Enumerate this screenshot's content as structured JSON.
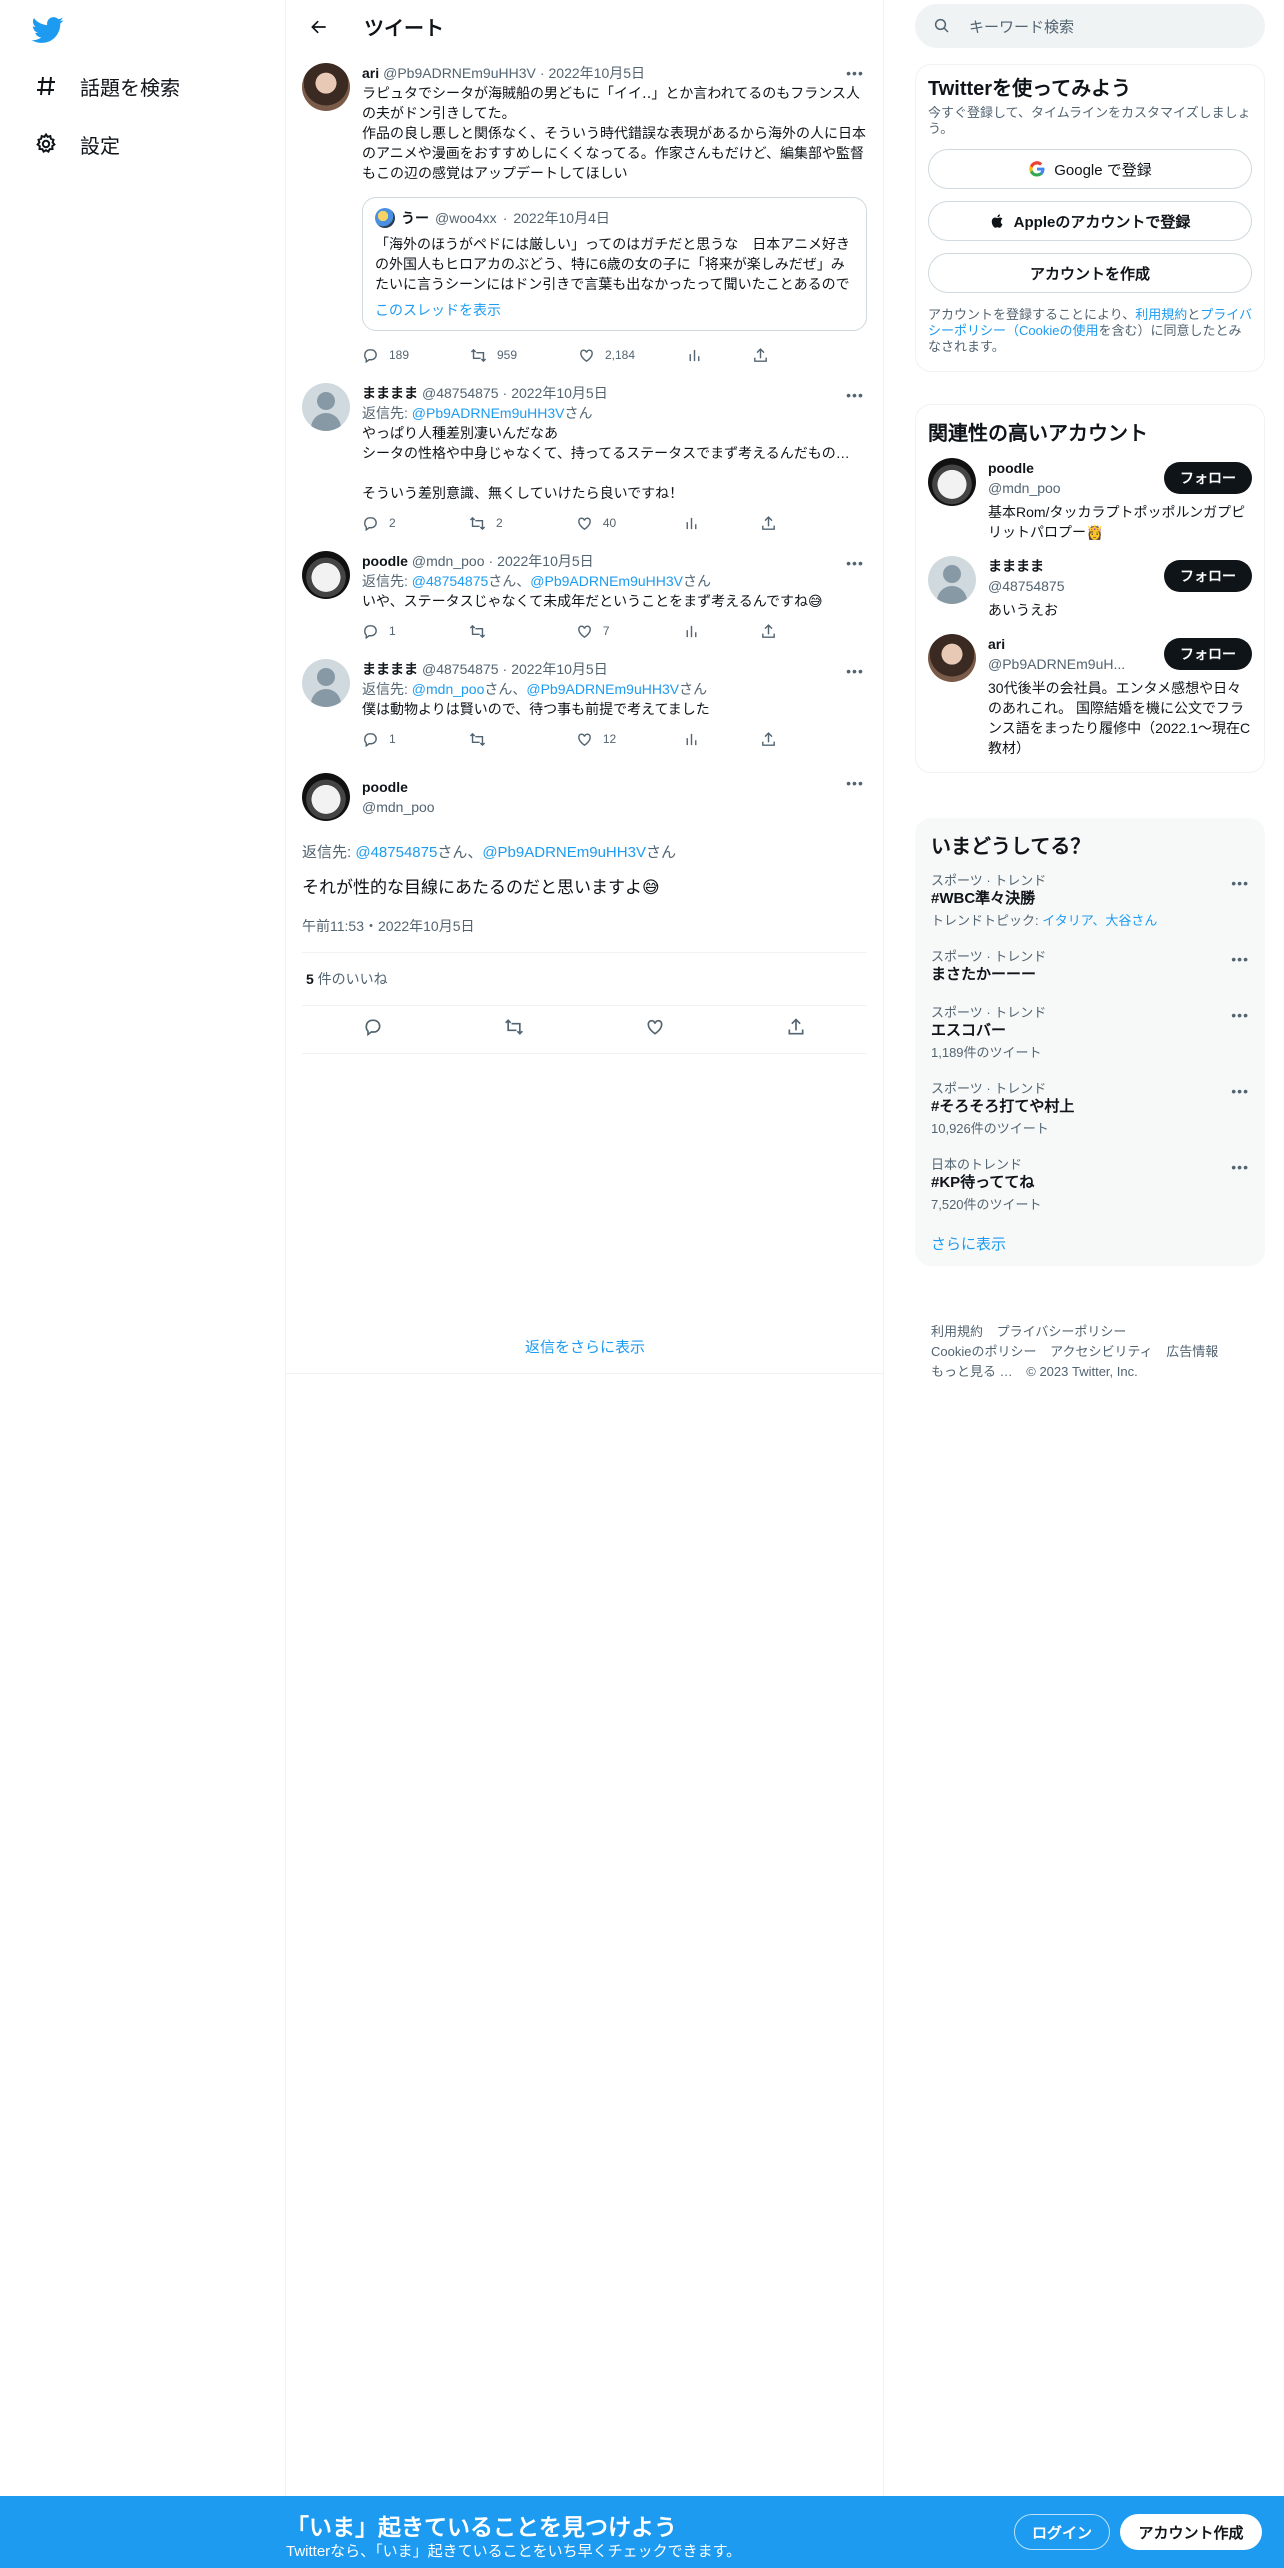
{
  "nav": {
    "explore": "話題を検索",
    "settings": "設定"
  },
  "header": {
    "title": "ツイート"
  },
  "thread": [
    {
      "name": "ari",
      "handle": "@Pb9ADRNEm9uHH3V",
      "date": "2022年10月5日",
      "text": "ラピュタでシータが海賊船の男どもに「イイ‥」とか言われてるのもフランス人の夫がドン引きしてた。\n作品の良し悪しと関係なく、そういう時代錯誤な表現があるから海外の人に日本のアニメや漫画をおすすめしにくくなってる。作家さんもだけど、編集部や監督もこの辺の感覚はアップデートしてほしい",
      "quote": {
        "name": "うー",
        "handle": "@woo4xx",
        "date": "2022年10月4日",
        "text": "「海外のほうがペドには厳しい」ってのはガチだと思うな　日本アニメ好きの外国人もヒロアカのぶどう、特に6歳の女の子に「将来が楽しみだぜ」みたいに言うシーンにはドン引きで言葉も出なかったって聞いたことあるので",
        "link": "このスレッドを表示"
      },
      "replies": "189",
      "retweets": "959",
      "likes": "2,184"
    },
    {
      "name": "まままま",
      "handle": "@48754875",
      "date": "2022年10月5日",
      "replyto_prefix": "返信先: ",
      "replyto": "@Pb9ADRNEm9uHH3V",
      "replyto_suffix": "さん",
      "text": "やっぱり人種差別凄いんだなあ\nシータの性格や中身じゃなくて、持ってるステータスでまず考えるんだもの…\n\nそういう差別意識、無くしていけたら良いですね！",
      "replies": "2",
      "retweets": "2",
      "likes": "40"
    },
    {
      "name": "poodle",
      "handle": "@mdn_poo",
      "date": "2022年10月5日",
      "replyto_prefix": "返信先: ",
      "replyto": "@48754875",
      "replyto_mid": "さん、",
      "replyto2": "@Pb9ADRNEm9uHH3V",
      "replyto_suffix": "さん",
      "text": "いや、ステータスじゃなくて未成年だということをまず考えるんですね😅",
      "replies": "1",
      "retweets": "",
      "likes": "7"
    },
    {
      "name": "まままま",
      "handle": "@48754875",
      "date": "2022年10月5日",
      "replyto_prefix": "返信先: ",
      "replyto": "@mdn_poo",
      "replyto_mid": "さん、",
      "replyto2": "@Pb9ADRNEm9uHH3V",
      "replyto_suffix": "さん",
      "text": "僕は動物よりは賢いので、待つ事も前提で考えてました",
      "replies": "1",
      "retweets": "",
      "likes": "12"
    }
  ],
  "focal": {
    "name": "poodle",
    "handle": "@mdn_poo",
    "replyto_prefix": "返信先: ",
    "replyto": "@48754875",
    "replyto_mid": "さん、",
    "replyto2": "@Pb9ADRNEm9uHH3V",
    "replyto_suffix": "さん",
    "text": "それが性的な目線にあたるのだと思いますよ😅",
    "time": "午前11:53・2022年10月5日",
    "likes_count": "5",
    "likes_label": " 件のいいね"
  },
  "more_replies": "返信をさらに表示",
  "search": {
    "placeholder": "キーワード検索"
  },
  "signup": {
    "title": "Twitterを使ってみよう",
    "subtitle": "今すぐ登録して、タイムラインをカスタマイズしましょう。",
    "google": "Google で登録",
    "apple": "Appleのアカウントで登録",
    "create": "アカウントを作成",
    "legal_1": "アカウントを登録することにより、",
    "legal_terms": "利用規約",
    "legal_2": "と",
    "legal_privacy": "プライバシーポリシー（Cookieの使用",
    "legal_3": "を含む）に同意したとみなされます。"
  },
  "relevant": {
    "title": "関連性の高いアカウント",
    "follow_label": "フォロー",
    "accounts": [
      {
        "name": "poodle",
        "handle": "@mdn_poo",
        "bio": "基本Rom/タッカラプトポッポルンガプピリットパロプー👸"
      },
      {
        "name": "まままま",
        "handle": "@48754875",
        "bio": "あいうえお"
      },
      {
        "name": "ari",
        "handle": "@Pb9ADRNEm9uH...",
        "bio": "30代後半の会社員。エンタメ感想や日々のあれこれ。 国際結婚を機に公文でフランス語をまったり履修中（2022.1〜現在C教材）"
      }
    ]
  },
  "trends": {
    "title": "いまどうしてる？",
    "items": [
      {
        "context": "スポーツ · トレンド",
        "title": "#WBC準々決勝",
        "sub_prefix": "トレンドトピック: ",
        "sub_links": "イタリア、大谷さん",
        "sub": ""
      },
      {
        "context": "スポーツ · トレンド",
        "title": "まさたかーーー",
        "sub": ""
      },
      {
        "context": "スポーツ · トレンド",
        "title": "エスコバー",
        "sub": "1,189件のツイート"
      },
      {
        "context": "スポーツ · トレンド",
        "title": "#そろそろ打てや村上",
        "sub": "10,926件のツイート"
      },
      {
        "context": "日本のトレンド",
        "title": "#KP待っててね",
        "sub": "7,520件のツイート"
      }
    ],
    "show_more": "さらに表示"
  },
  "footer": {
    "terms": "利用規約",
    "privacy": "プライバシーポリシー",
    "cookie": "Cookieのポリシー",
    "accessibility": "アクセシビリティ",
    "ads": "広告情報",
    "more": "もっと見る …",
    "copyright": "© 2023 Twitter, Inc."
  },
  "bottombar": {
    "title": "「いま」起きていることを見つけよう",
    "subtitle": "Twitterなら、「いま」起きていることをいち早くチェックできます。",
    "login": "ログイン",
    "create": "アカウント作成"
  },
  "colors": {
    "accent": "#1d9bf0",
    "text": "#0f1419",
    "muted": "#536471"
  }
}
